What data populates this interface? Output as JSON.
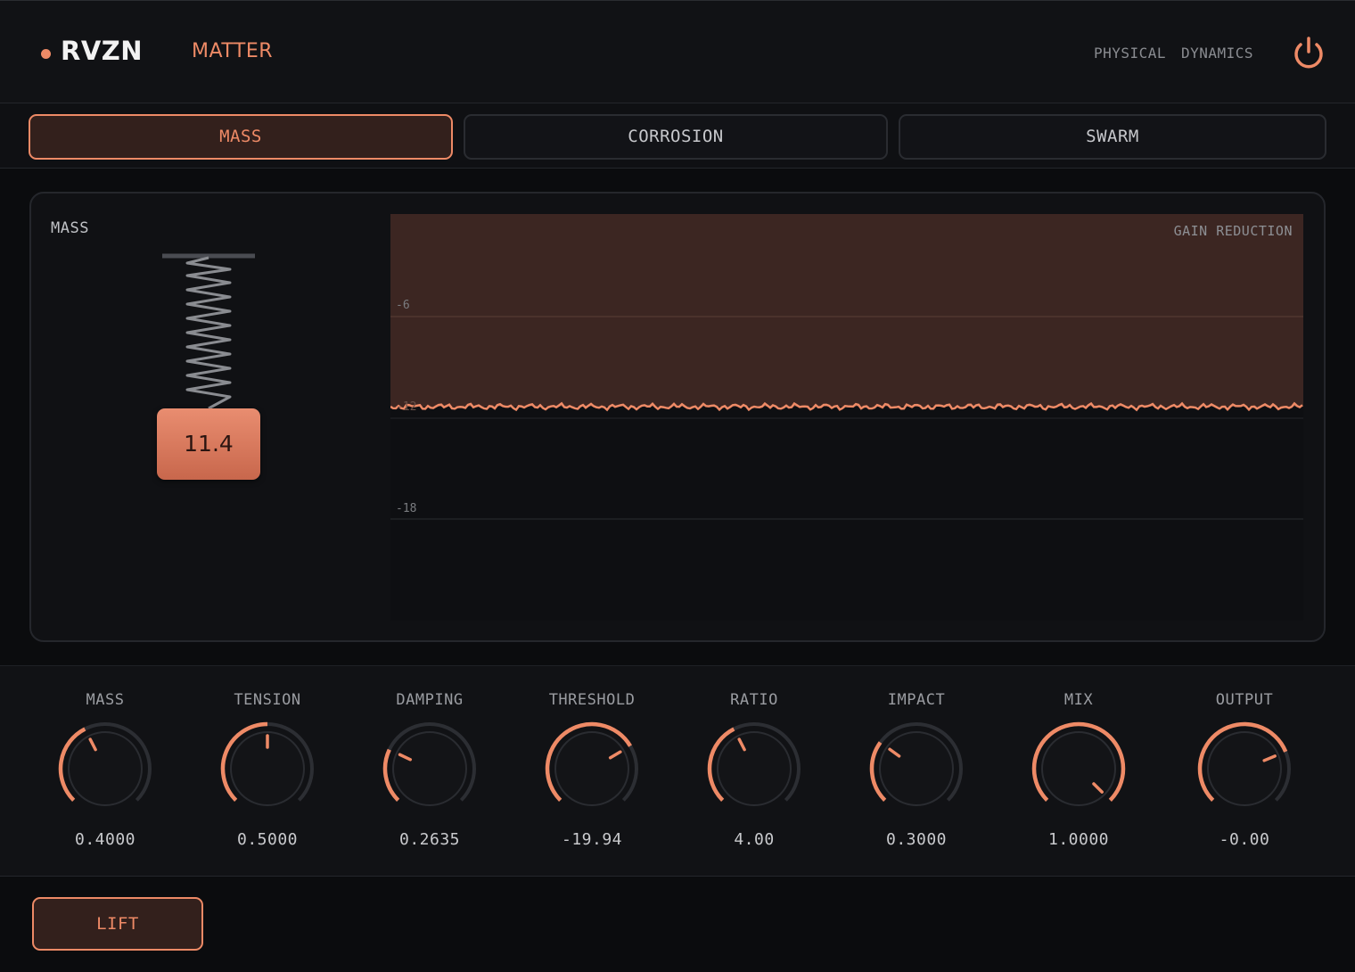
{
  "header": {
    "brand": "RVZN",
    "product": "MATTER",
    "tags": [
      "PHYSICAL",
      "DYNAMICS"
    ],
    "accent": "#ee8a66",
    "power_icon": "power-icon"
  },
  "tabs": [
    {
      "label": "MASS",
      "active": true
    },
    {
      "label": "CORROSION",
      "active": false
    },
    {
      "label": "SWARM",
      "active": false
    }
  ],
  "visualizer": {
    "label": "MASS",
    "mass_value": "11.4",
    "gain_reduction_label": "GAIN REDUCTION",
    "grid_labels": [
      "-6",
      "-12",
      "-18"
    ]
  },
  "knobs": [
    {
      "label": "MASS",
      "value": "0.4000",
      "level": 0.4
    },
    {
      "label": "TENSION",
      "value": "0.5000",
      "level": 0.5
    },
    {
      "label": "DAMPING",
      "value": "0.2635",
      "level": 0.26
    },
    {
      "label": "THRESHOLD",
      "value": "-19.94",
      "level": 0.72
    },
    {
      "label": "RATIO",
      "value": "4.00",
      "level": 0.4
    },
    {
      "label": "IMPACT",
      "value": "0.3000",
      "level": 0.3
    },
    {
      "label": "MIX",
      "value": "1.0000",
      "level": 1.0
    },
    {
      "label": "OUTPUT",
      "value": "-0.00",
      "level": 0.75
    }
  ],
  "footer": {
    "lift_label": "LIFT"
  }
}
